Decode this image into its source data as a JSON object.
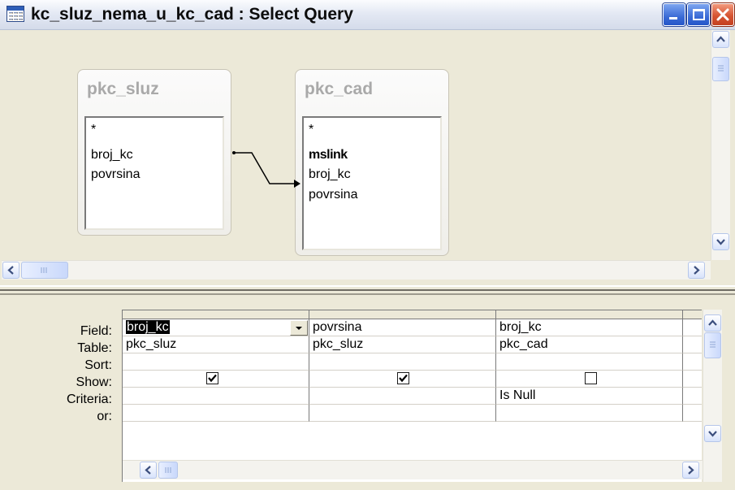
{
  "window": {
    "title": "kc_sluz_nema_u_kc_cad : Select Query",
    "icon": "query-icon",
    "controls": [
      "minimize",
      "maximize",
      "close"
    ]
  },
  "field_lists": [
    {
      "name": "pkc_sluz",
      "fields": [
        "*",
        "broj_kc",
        "povrsina"
      ],
      "key_fields": []
    },
    {
      "name": "pkc_cad",
      "fields": [
        "*",
        "mslink",
        "broj_kc",
        "povrsina"
      ],
      "key_fields": [
        "mslink"
      ]
    }
  ],
  "relationship": {
    "from_table": "pkc_sluz",
    "from_field": "broj_kc",
    "to_table": "pkc_cad",
    "to_field": "broj_kc"
  },
  "grid": {
    "row_labels": [
      "Field:",
      "Table:",
      "Sort:",
      "Show:",
      "Criteria:",
      "or:"
    ],
    "columns": [
      {
        "field": "broj_kc",
        "table": "pkc_sluz",
        "sort": "",
        "show": true,
        "criteria": "",
        "or": "",
        "selected": true
      },
      {
        "field": "povrsina",
        "table": "pkc_sluz",
        "sort": "",
        "show": true,
        "criteria": "",
        "or": ""
      },
      {
        "field": "broj_kc",
        "table": "pkc_cad",
        "sort": "",
        "show": false,
        "criteria": "Is Null",
        "or": ""
      }
    ]
  },
  "colors": {
    "dialog_bg": "#ece9d8",
    "close_red": "#d65533",
    "caption_text": "#0c0c0c",
    "fieldlist_title": "#a9a9a9"
  }
}
